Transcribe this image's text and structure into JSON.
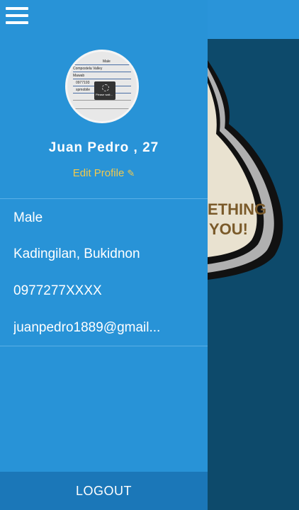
{
  "header": {
    "menu_icon": "hamburger-menu-icon"
  },
  "profile": {
    "name": "Juan Pedro , 27",
    "edit_label": "Edit Profile",
    "edit_icon": "pencil-icon",
    "avatar_texts": [
      "Male",
      "Compostela Valley",
      "Mawab",
      "0977193",
      "spmobile",
      "Please wait..."
    ]
  },
  "details": {
    "gender": "Male",
    "location": "Kadingilan, Bukidnon",
    "phone": "0977277XXXX",
    "email": "juanpedro1889@gmail..."
  },
  "footer": {
    "logout_label": "LOGOUT"
  },
  "background_sign": {
    "text_line1": "ETHING",
    "text_line2": "YOU!"
  },
  "colors": {
    "drawer": "#2893d7",
    "logout_bar": "#1b77b8",
    "accent": "#f2c94c",
    "background_panel": "#0d4a6b"
  }
}
